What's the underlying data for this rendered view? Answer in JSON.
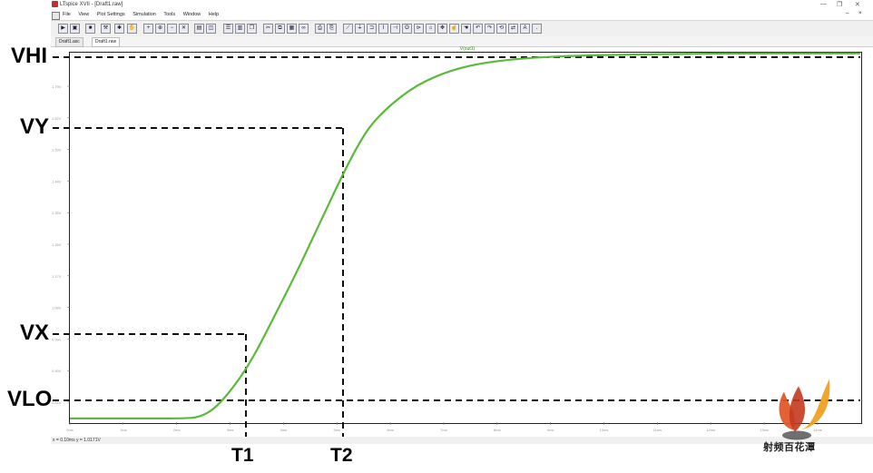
{
  "window": {
    "title": "LTspice XVII - [Draft1.raw]",
    "buttons": {
      "minimize": "—",
      "restore": "❐",
      "close": "✕"
    }
  },
  "menu": [
    "File",
    "View",
    "Plot Settings",
    "Simulation",
    "Tools",
    "Window",
    "Help"
  ],
  "tabs": [
    {
      "label": "Draft1.asc",
      "active": false
    },
    {
      "label": "Draft1.raw",
      "active": true
    }
  ],
  "plot": {
    "trace_name": "V(out1)",
    "trace_color": "#5ab93a",
    "y_ticks": [
      "1.79V",
      "1.62V",
      "1.53V",
      "1.44V",
      "1.35V",
      "1.26V",
      "1.17V",
      "1.08V",
      "0.99V",
      "0.90V",
      "0.81V"
    ],
    "x_ticks": [
      "0ms",
      "1ms",
      "2ms",
      "3ms",
      "4ms",
      "5ms",
      "6ms",
      "7ms",
      "8ms",
      "9ms",
      "10ms",
      "11ms",
      "12ms",
      "13ms",
      "14ms"
    ]
  },
  "status": {
    "cursor": "x = 0.10ms   y = 1.0171V"
  },
  "annotations": {
    "vhi": "VHI",
    "vy": "VY",
    "vx": "VX",
    "vlo": "VLO",
    "t1": "T1",
    "t2": "T2"
  },
  "watermark": {
    "text": "射频百花潭",
    "colors": [
      "#e2582a",
      "#f0a020",
      "#c23a1e"
    ]
  },
  "chart_data": {
    "type": "line",
    "series": [
      {
        "name": "V(out1)",
        "x": [
          0,
          1,
          2,
          2.3,
          2.6,
          3,
          3.3,
          3.6,
          4,
          4.4,
          4.8,
          5.1,
          5.4,
          6,
          6.6,
          7.2,
          8,
          9,
          10,
          11,
          12,
          13,
          14
        ],
        "y": [
          0.81,
          0.81,
          0.81,
          0.813,
          0.84,
          0.915,
          0.99,
          1.08,
          1.2,
          1.33,
          1.46,
          1.55,
          1.62,
          1.7,
          1.745,
          1.77,
          1.785,
          1.792,
          1.795,
          1.797,
          1.798,
          1.798,
          1.798
        ]
      }
    ],
    "xlim": [
      0,
      14
    ],
    "ylim": [
      0.8,
      1.8
    ],
    "xlabel": "",
    "ylabel": "",
    "title": ""
  }
}
